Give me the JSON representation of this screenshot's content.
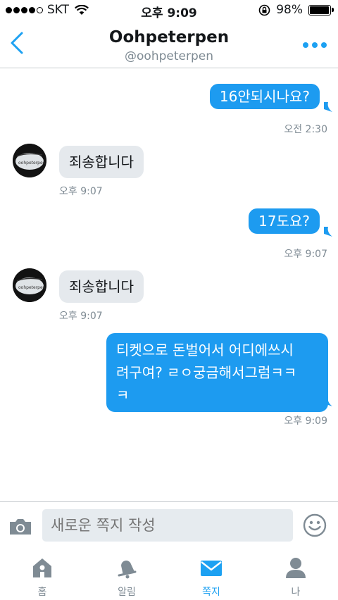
{
  "status_bar": {
    "carrier": "SKT",
    "time": "오후 9:09",
    "battery": "98%",
    "battery_level": 0.98,
    "signal_bars": 4
  },
  "header": {
    "title": "Oohpeterpen",
    "subtitle": "@oohpeterpen"
  },
  "messages": [
    {
      "side": "out",
      "text": "16안되시나요?",
      "time": "오전 2:30"
    },
    {
      "side": "in",
      "text": "죄송합니다",
      "time": "오후 9:07"
    },
    {
      "side": "out",
      "text": "17도요?",
      "time": "오후 9:07"
    },
    {
      "side": "in",
      "text": "죄송합니다",
      "time": "오후 9:07"
    },
    {
      "side": "out",
      "lines": [
        "티켓으로 돈벌어서 어디에쓰시",
        "려구여? ㄹㅇ궁금해서그럼ㅋㅋ",
        "ㅋ"
      ],
      "time": "오후 9:09"
    }
  ],
  "avatar_caption": "oohpeterpen",
  "compose": {
    "placeholder": "새로운 쪽지 작성"
  },
  "tabs": [
    {
      "label": "홈",
      "icon": "home-icon"
    },
    {
      "label": "알림",
      "icon": "bell-icon"
    },
    {
      "label": "쪽지",
      "icon": "envelope-icon",
      "active": true
    },
    {
      "label": "나",
      "icon": "person-icon"
    }
  ],
  "colors": {
    "accent": "#1da1f2",
    "bubble_out": "#1d9bf0",
    "bubble_in": "#e5e9ed",
    "muted": "#7f8b94"
  }
}
